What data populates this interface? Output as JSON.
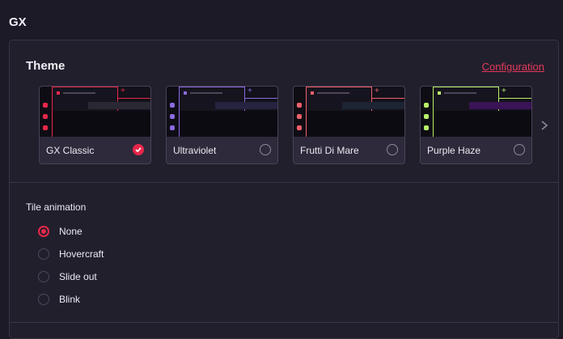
{
  "page": {
    "title": "GX"
  },
  "theme_section": {
    "title": "Theme",
    "config_link": "Configuration",
    "themes": [
      {
        "name": "GX Classic",
        "accent": "#e8274a",
        "bar": "#2a2833",
        "selected": true
      },
      {
        "name": "Ultraviolet",
        "accent": "#8a6ae0",
        "bar": "#262340",
        "selected": false
      },
      {
        "name": "Frutti Di Mare",
        "accent": "#f0606a",
        "bar": "#1d2434",
        "selected": false
      },
      {
        "name": "Purple Haze",
        "accent": "#b8f06a",
        "bar": "#3a1456",
        "selected": false
      }
    ]
  },
  "tile_animation": {
    "title": "Tile animation",
    "options": [
      {
        "label": "None",
        "selected": true
      },
      {
        "label": "Hovercraft",
        "selected": false
      },
      {
        "label": "Slide out",
        "selected": false
      },
      {
        "label": "Blink",
        "selected": false
      }
    ]
  },
  "icons": {
    "next": "chevron-right-icon",
    "check": "check-icon"
  }
}
